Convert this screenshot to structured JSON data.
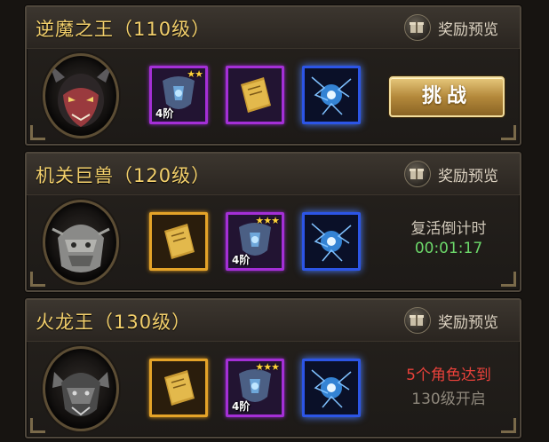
{
  "bosses": [
    {
      "title": "逆魔之王（110级）",
      "preview_label": "奖励预览",
      "portrait": "demon-king-portrait",
      "rewards": [
        {
          "type": "purple-armor",
          "stars": "★★",
          "tier": "4阶"
        },
        {
          "type": "purple-book"
        },
        {
          "type": "blue-energy-orb"
        }
      ],
      "action": {
        "label": "挑战"
      }
    },
    {
      "title": "机关巨兽（120级）",
      "preview_label": "奖励预览",
      "portrait": "mechanical-beast-portrait",
      "rewards": [
        {
          "type": "gold-book"
        },
        {
          "type": "purple-armor",
          "stars": "★★★",
          "tier": "4阶"
        },
        {
          "type": "blue-energy-orb"
        }
      ],
      "status": {
        "line1": "复活倒计时",
        "line2": "00:01:17"
      }
    },
    {
      "title": "火龙王（130级）",
      "preview_label": "奖励预览",
      "portrait": "fire-dragon-king-portrait",
      "rewards": [
        {
          "type": "gold-book"
        },
        {
          "type": "purple-armor",
          "stars": "★★★",
          "tier": "4阶"
        },
        {
          "type": "blue-energy-orb"
        }
      ],
      "status": {
        "line1": "5个角色达到",
        "line2": "130级开启"
      }
    }
  ],
  "colors": {
    "title": "#f2cf6b",
    "challenge_button": "#b4893b",
    "countdown_green": "#6cd86a",
    "requirement_red": "#e8413a",
    "slot_purple": "#a42fd6",
    "slot_gold": "#e4a328",
    "slot_blue": "#2c55e6"
  }
}
